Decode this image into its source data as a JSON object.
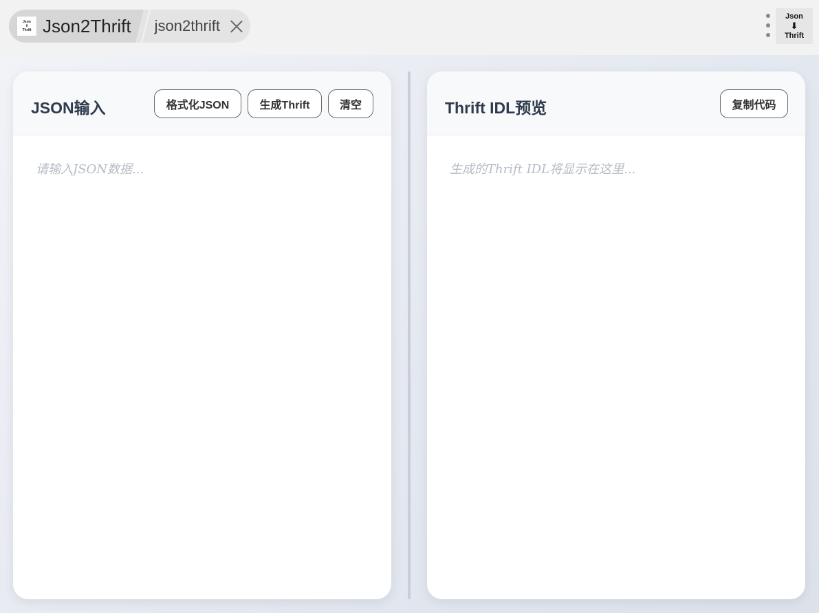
{
  "breadcrumb": {
    "app_icon_lines": [
      "Json",
      "⬇",
      "Thrift"
    ],
    "app_title": "Json2Thrift",
    "tab_label": "json2thrift"
  },
  "extension_icon": {
    "top": "Json",
    "arrow": "⬇",
    "bottom": "Thrift"
  },
  "left_panel": {
    "title": "JSON输入",
    "buttons": {
      "format": "格式化JSON",
      "generate": "生成Thrift",
      "clear": "清空"
    },
    "placeholder": "请输入JSON数据..."
  },
  "right_panel": {
    "title": "Thrift IDL预览",
    "buttons": {
      "copy": "复制代码"
    },
    "placeholder": "生成的Thrift IDL将显示在这里..."
  }
}
